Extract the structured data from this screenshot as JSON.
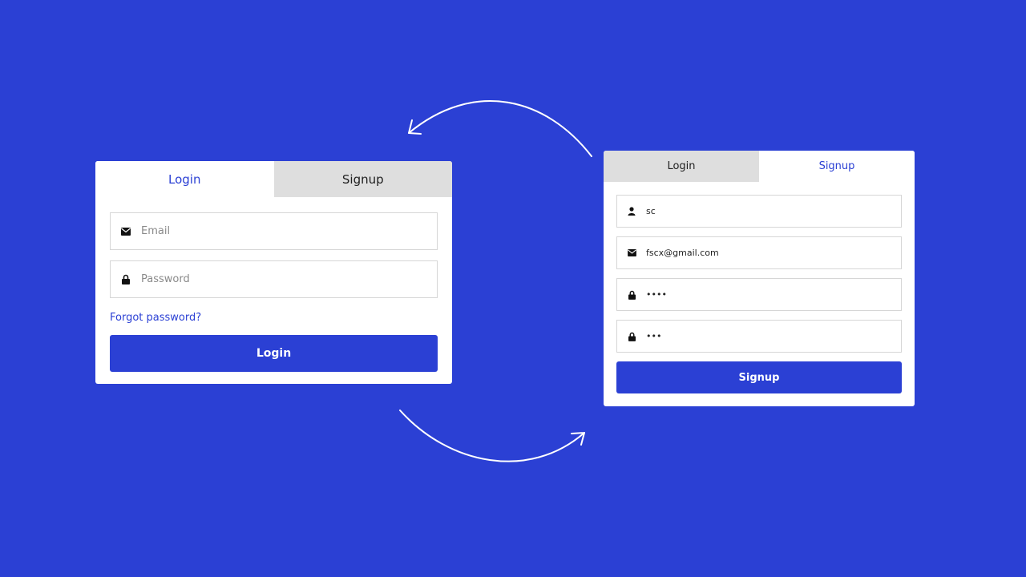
{
  "colors": {
    "background": "#2b40d4",
    "accent": "#2b40d4",
    "inactive_tab": "#dedede"
  },
  "login_form": {
    "tabs": [
      {
        "label": "Login",
        "active": true
      },
      {
        "label": "Signup",
        "active": false
      }
    ],
    "email": {
      "placeholder": "Email",
      "value": "",
      "icon": "envelope-icon"
    },
    "password": {
      "placeholder": "Password",
      "value": "",
      "icon": "lock-icon"
    },
    "forgot_label": "Forgot password?",
    "submit_label": "Login"
  },
  "signup_form": {
    "tabs": [
      {
        "label": "Login",
        "active": false
      },
      {
        "label": "Signup",
        "active": true
      }
    ],
    "name": {
      "value": "sc",
      "icon": "user-icon"
    },
    "email": {
      "value": "fscx@gmail.com",
      "icon": "envelope-icon"
    },
    "password": {
      "value": "••••",
      "icon": "lock-icon"
    },
    "confirm_password": {
      "value": "•••",
      "icon": "lock-icon"
    },
    "submit_label": "Signup"
  }
}
